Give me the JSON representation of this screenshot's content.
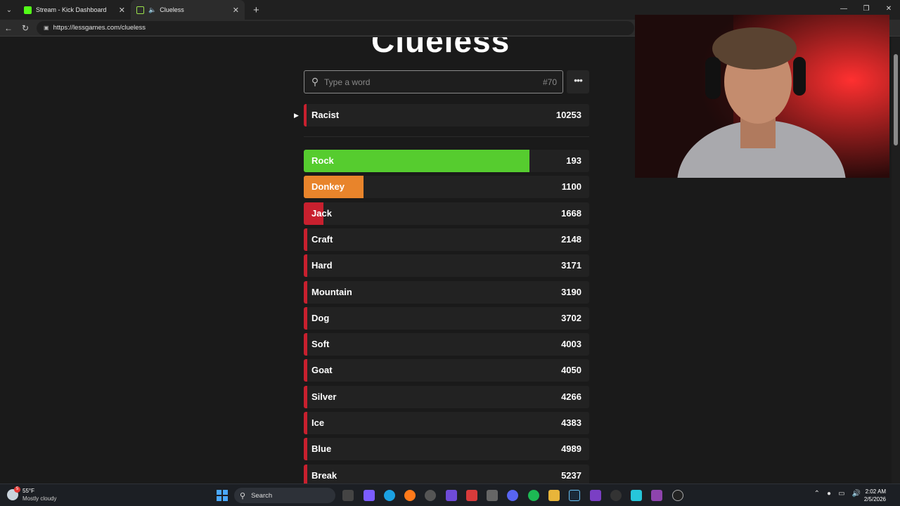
{
  "browser": {
    "tabs": [
      {
        "title": "Stream - Kick Dashboard"
      },
      {
        "title": "Clueless"
      }
    ],
    "url": "https://lessgames.com/clueless"
  },
  "game": {
    "title": "Clueless",
    "search_placeholder": "Type a word",
    "game_number": "#70",
    "more_label": "•••",
    "last_guess": {
      "word": "Racist",
      "score": "10253"
    },
    "guesses": [
      {
        "word": "Rock",
        "score": "193",
        "fill": 0.79,
        "color": "#56cc2f"
      },
      {
        "word": "Donkey",
        "score": "1100",
        "fill": 0.21,
        "color": "#e8842b"
      },
      {
        "word": "Jack",
        "score": "1668",
        "fill": 0.07,
        "color": "#c8202e"
      },
      {
        "word": "Craft",
        "score": "2148",
        "fill": 0.012,
        "color": "#c8202e"
      },
      {
        "word": "Hard",
        "score": "3171",
        "fill": 0.012,
        "color": "#c8202e"
      },
      {
        "word": "Mountain",
        "score": "3190",
        "fill": 0.012,
        "color": "#c8202e"
      },
      {
        "word": "Dog",
        "score": "3702",
        "fill": 0.012,
        "color": "#c8202e"
      },
      {
        "word": "Soft",
        "score": "4003",
        "fill": 0.012,
        "color": "#c8202e"
      },
      {
        "word": "Goat",
        "score": "4050",
        "fill": 0.012,
        "color": "#c8202e"
      },
      {
        "word": "Silver",
        "score": "4266",
        "fill": 0.012,
        "color": "#c8202e"
      },
      {
        "word": "Ice",
        "score": "4383",
        "fill": 0.012,
        "color": "#c8202e"
      },
      {
        "word": "Blue",
        "score": "4989",
        "fill": 0.012,
        "color": "#c8202e"
      },
      {
        "word": "Break",
        "score": "5237",
        "fill": 0.012,
        "color": "#c8202e"
      }
    ]
  },
  "taskbar": {
    "weather_temp": "55°F",
    "weather_desc": "Mostly cloudy",
    "weather_badge": "5",
    "search_label": "Search",
    "time": "2:02 AM",
    "date": "2/5/2026"
  }
}
